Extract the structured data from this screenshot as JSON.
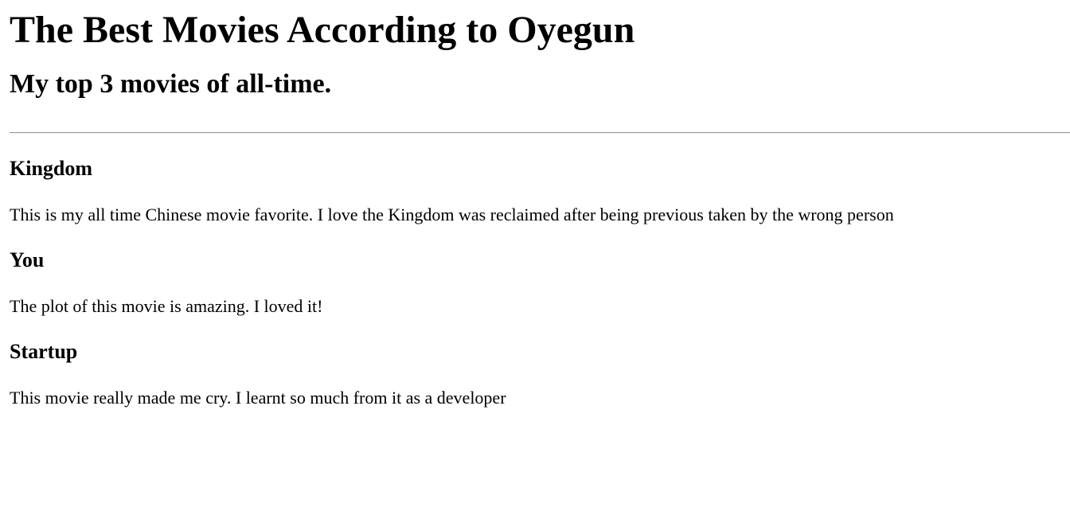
{
  "page": {
    "title": "The Best Movies According to Oyegun",
    "subtitle": "My top 3 movies of all-time."
  },
  "movies": [
    {
      "title": "Kingdom",
      "description": "This is my all time Chinese movie favorite. I love the Kingdom was reclaimed after being previous taken by the wrong person"
    },
    {
      "title": "You",
      "description": "The plot of this movie is amazing. I loved it!"
    },
    {
      "title": "Startup",
      "description": "This movie really made me cry. I learnt so much from it as a developer"
    }
  ]
}
